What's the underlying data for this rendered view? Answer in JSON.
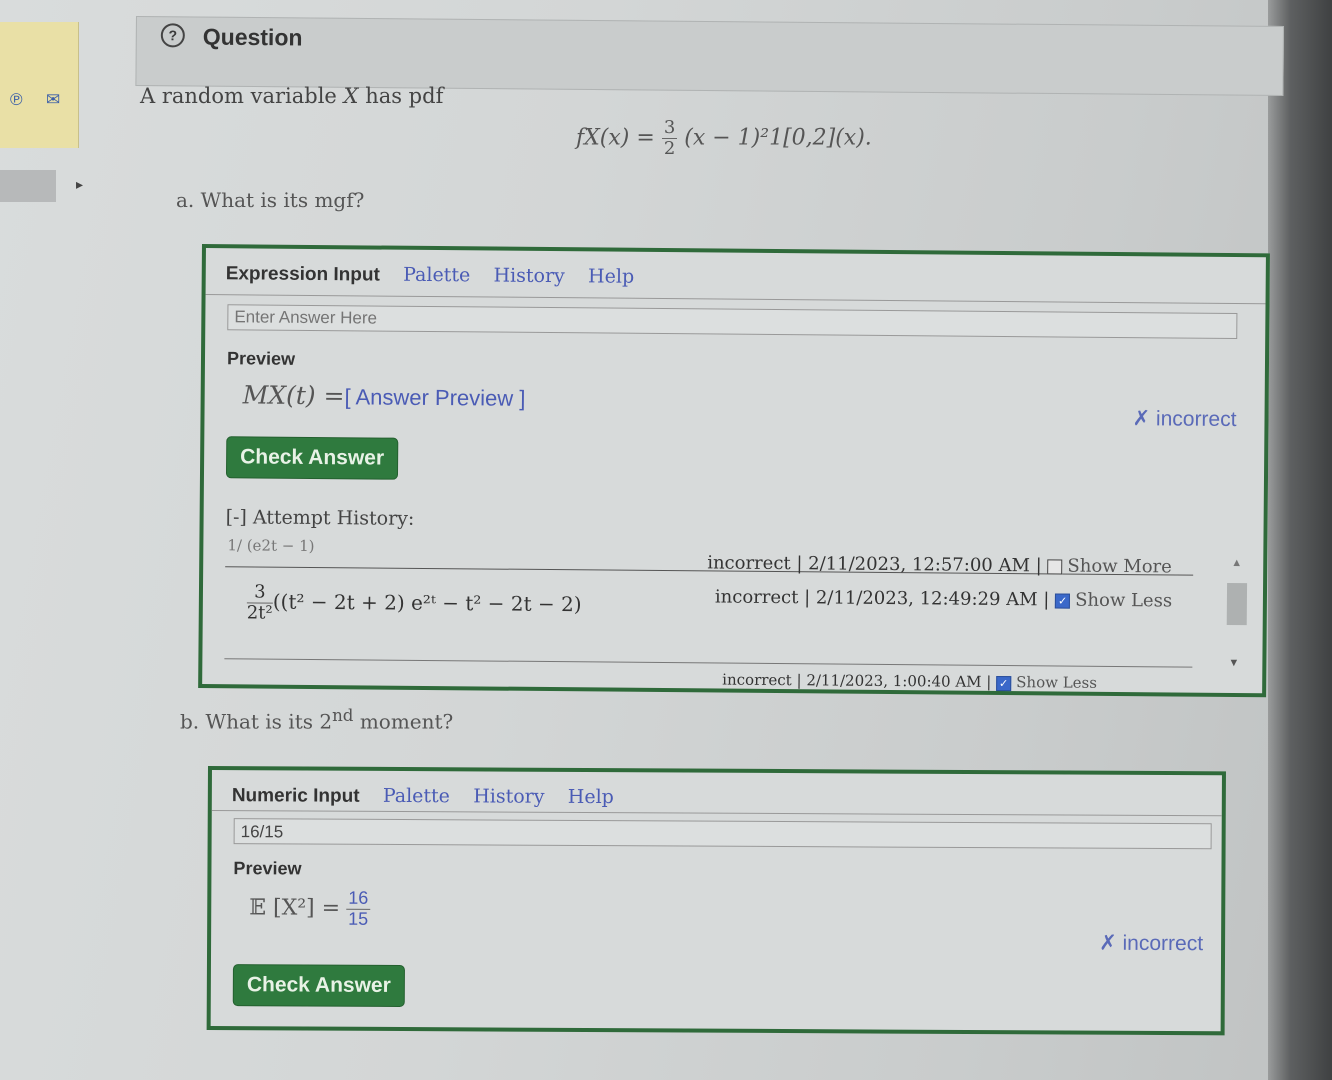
{
  "sidebar": {
    "icons": [
      "pinterest-icon",
      "mail-icon"
    ],
    "pin_glyph": "℗",
    "mail_glyph": "✉",
    "expand_glyph": "▸"
  },
  "question": {
    "header_icon": "?",
    "title": "Question",
    "intro_prefix": "A random variable",
    "intro_var": "X",
    "intro_suffix": "has pdf",
    "pdf_lhs": "fX(x) =",
    "pdf_frac_num": "3",
    "pdf_frac_den": "2",
    "pdf_rhs": "(x − 1)²1[0,2](x).",
    "part_a": "a. What is its mgf?",
    "part_b_prefix": "b. What is its 2",
    "part_b_sup": "nd",
    "part_b_suffix": "moment?"
  },
  "part_a": {
    "tabs": {
      "active": "Expression Input",
      "palette": "Palette",
      "history": "History",
      "help": "Help"
    },
    "input": {
      "value": "",
      "placeholder": "Enter Answer Here"
    },
    "preview_label": "Preview",
    "preview_lhs": "MX(t) =",
    "preview_value": "[ Answer Preview ]",
    "status": "✗ incorrect",
    "check_button": "Check Answer",
    "attempt_history_label": "[-] Attempt History:",
    "attempts": [
      {
        "expr": "1/ (e2t − 1)",
        "status": "incorrect",
        "timestamp": "2/11/2023, 12:57:00 AM",
        "toggle": "Show More",
        "checked": false
      },
      {
        "expr_num": "3",
        "expr_den": "2t²",
        "expr_rest": "((t² − 2t + 2) e²ᵗ − t² − 2t − 2)",
        "status": "incorrect",
        "timestamp": "2/11/2023, 12:49:29 AM",
        "toggle": "Show Less",
        "checked": true
      },
      {
        "expr": "",
        "status": "incorrect",
        "timestamp": "2/11/2023, 1:00:40 AM",
        "toggle": "Show Less",
        "checked": true
      }
    ]
  },
  "part_b": {
    "tabs": {
      "active": "Numeric Input",
      "palette": "Palette",
      "history": "History",
      "help": "Help"
    },
    "input": {
      "value": "16/15",
      "placeholder": ""
    },
    "preview_label": "Preview",
    "preview_lhs": "𝔼 [X²] =",
    "preview_num": "16",
    "preview_den": "15",
    "status": "✗ incorrect",
    "check_button": "Check Answer"
  }
}
